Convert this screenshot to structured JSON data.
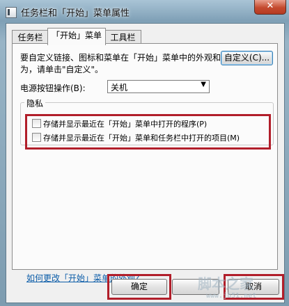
{
  "window": {
    "title": "任务栏和「开始」菜单属性",
    "close_glyph": "✕"
  },
  "tabs": [
    {
      "label": "任务栏",
      "active": false
    },
    {
      "label": "「开始」菜单",
      "active": true
    },
    {
      "label": "工具栏",
      "active": false
    }
  ],
  "start_menu": {
    "customize_text": "要自定义链接、图标和菜单在「开始」菜单中的外观和行为，请单击\"自定义\"。",
    "customize_button": "自定义(C)...",
    "power_label": "电源按钮操作(B):",
    "power_value": "关机",
    "privacy_title": "隐私",
    "checkbox_programs": "存储并显示最近在「开始」菜单中打开的程序(P)",
    "checkbox_items": "存储并显示最近在「开始」菜单和任务栏中打开的项目(M)",
    "checkbox_programs_checked": false,
    "checkbox_items_checked": false,
    "appearance_link": "如何更改「开始」菜单的外观?"
  },
  "footer": {
    "ok": "确定",
    "cancel": "取消"
  },
  "watermark": {
    "large": "脚本之家",
    "small": "www.jb51.net"
  },
  "colors": {
    "highlight_box": "#b11e2a",
    "link": "#0b5ca8"
  }
}
